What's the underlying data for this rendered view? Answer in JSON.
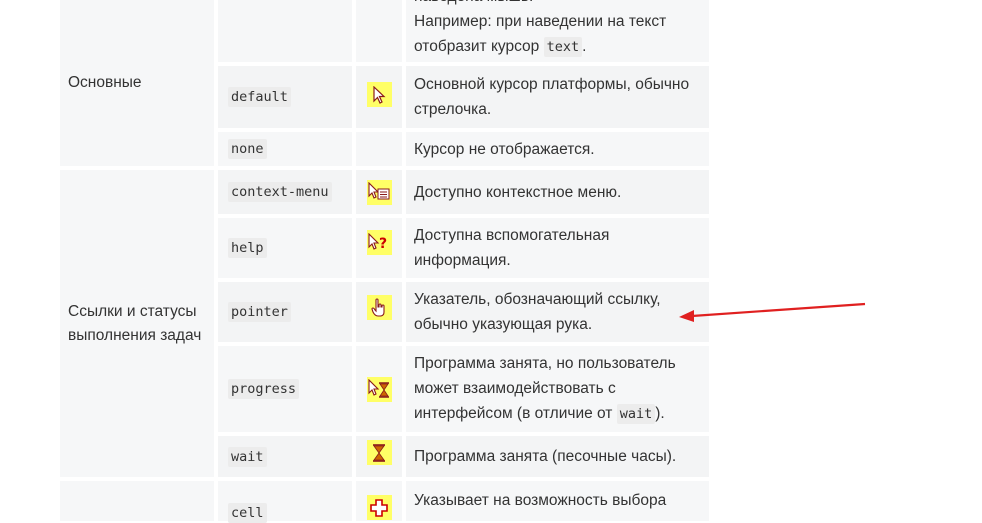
{
  "categories": [
    {
      "label": "Основные"
    },
    {
      "label": "Ссылки и статусы выполнения задач"
    }
  ],
  "rows": [
    {
      "value": "",
      "icon": "",
      "description_lines": [
        "наведена мышь.",
        "Например: при наведении на текст"
      ],
      "description_tail_pre": "отобразит курсор ",
      "description_tail_code": "text",
      "description_tail_post": "."
    },
    {
      "value": "default",
      "icon": "default-arrow-cursor-icon",
      "description": "Основной курсор платформы, обычно стрелочка."
    },
    {
      "value": "none",
      "icon": "",
      "description": "Курсор не отображается."
    },
    {
      "value": "context-menu",
      "icon": "context-menu-cursor-icon",
      "description": "Доступно контекстное меню."
    },
    {
      "value": "help",
      "icon": "help-cursor-icon",
      "description": "Доступна вспомогательная информация."
    },
    {
      "value": "pointer",
      "icon": "pointer-hand-cursor-icon",
      "description": "Указатель, обозначающий ссылку, обычно указующая рука."
    },
    {
      "value": "progress",
      "icon": "progress-cursor-icon",
      "description_pre": "Программа занята, но пользователь может взаимодействовать с интерфейсом (в отличие от ",
      "description_code": "wait",
      "description_post": ")."
    },
    {
      "value": "wait",
      "icon": "hourglass-cursor-icon",
      "description": "Программа занята (песочные часы)."
    },
    {
      "value": "cell",
      "icon": "cell-cross-cursor-icon",
      "description": "Указывает на возможность выбора"
    }
  ],
  "colors": {
    "cell_bg": "#f6f7f8",
    "code_bg": "#ececec",
    "icon_bg": "#ffff66",
    "arrow": "#e02020",
    "text": "#333333"
  }
}
